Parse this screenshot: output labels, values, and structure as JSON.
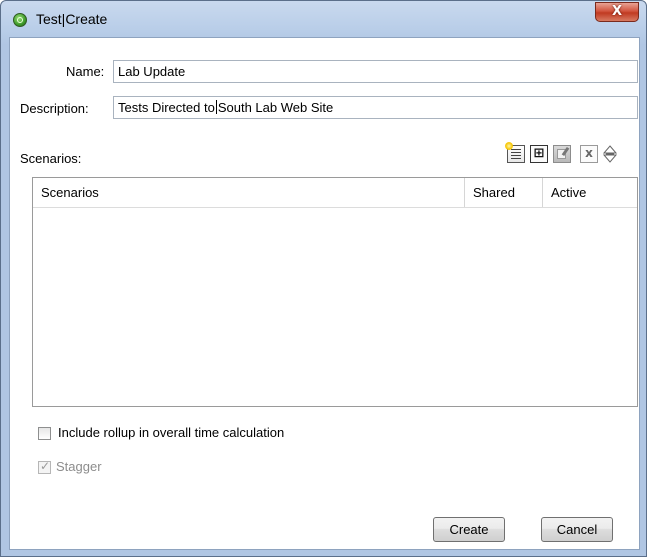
{
  "window": {
    "title": "Test|Create",
    "close_glyph": "X"
  },
  "form": {
    "name_label": "Name:",
    "name_value": "Lab Update",
    "description_label": "Description:",
    "description_value_before_caret": "Tests Directed to",
    "description_value_after_caret": "South Lab Web Site",
    "scenarios_label": "Scenarios:"
  },
  "toolbar": {
    "icons": [
      "add-scenario-icon",
      "add-row-icon",
      "edit-icon",
      "delete-icon",
      "sort-icon"
    ],
    "add_row_glyph": "⊞",
    "delete_glyph": "x"
  },
  "scenarios_table": {
    "columns": [
      "Scenarios",
      "Shared",
      "Active"
    ],
    "rows": []
  },
  "options": {
    "rollup_label": "Include rollup in overall time calculation",
    "rollup_checked": false,
    "stagger_label": "Stagger",
    "stagger_checked": true,
    "stagger_enabled": false,
    "check_glyph": "✓"
  },
  "buttons": {
    "create": "Create",
    "cancel": "Cancel"
  }
}
